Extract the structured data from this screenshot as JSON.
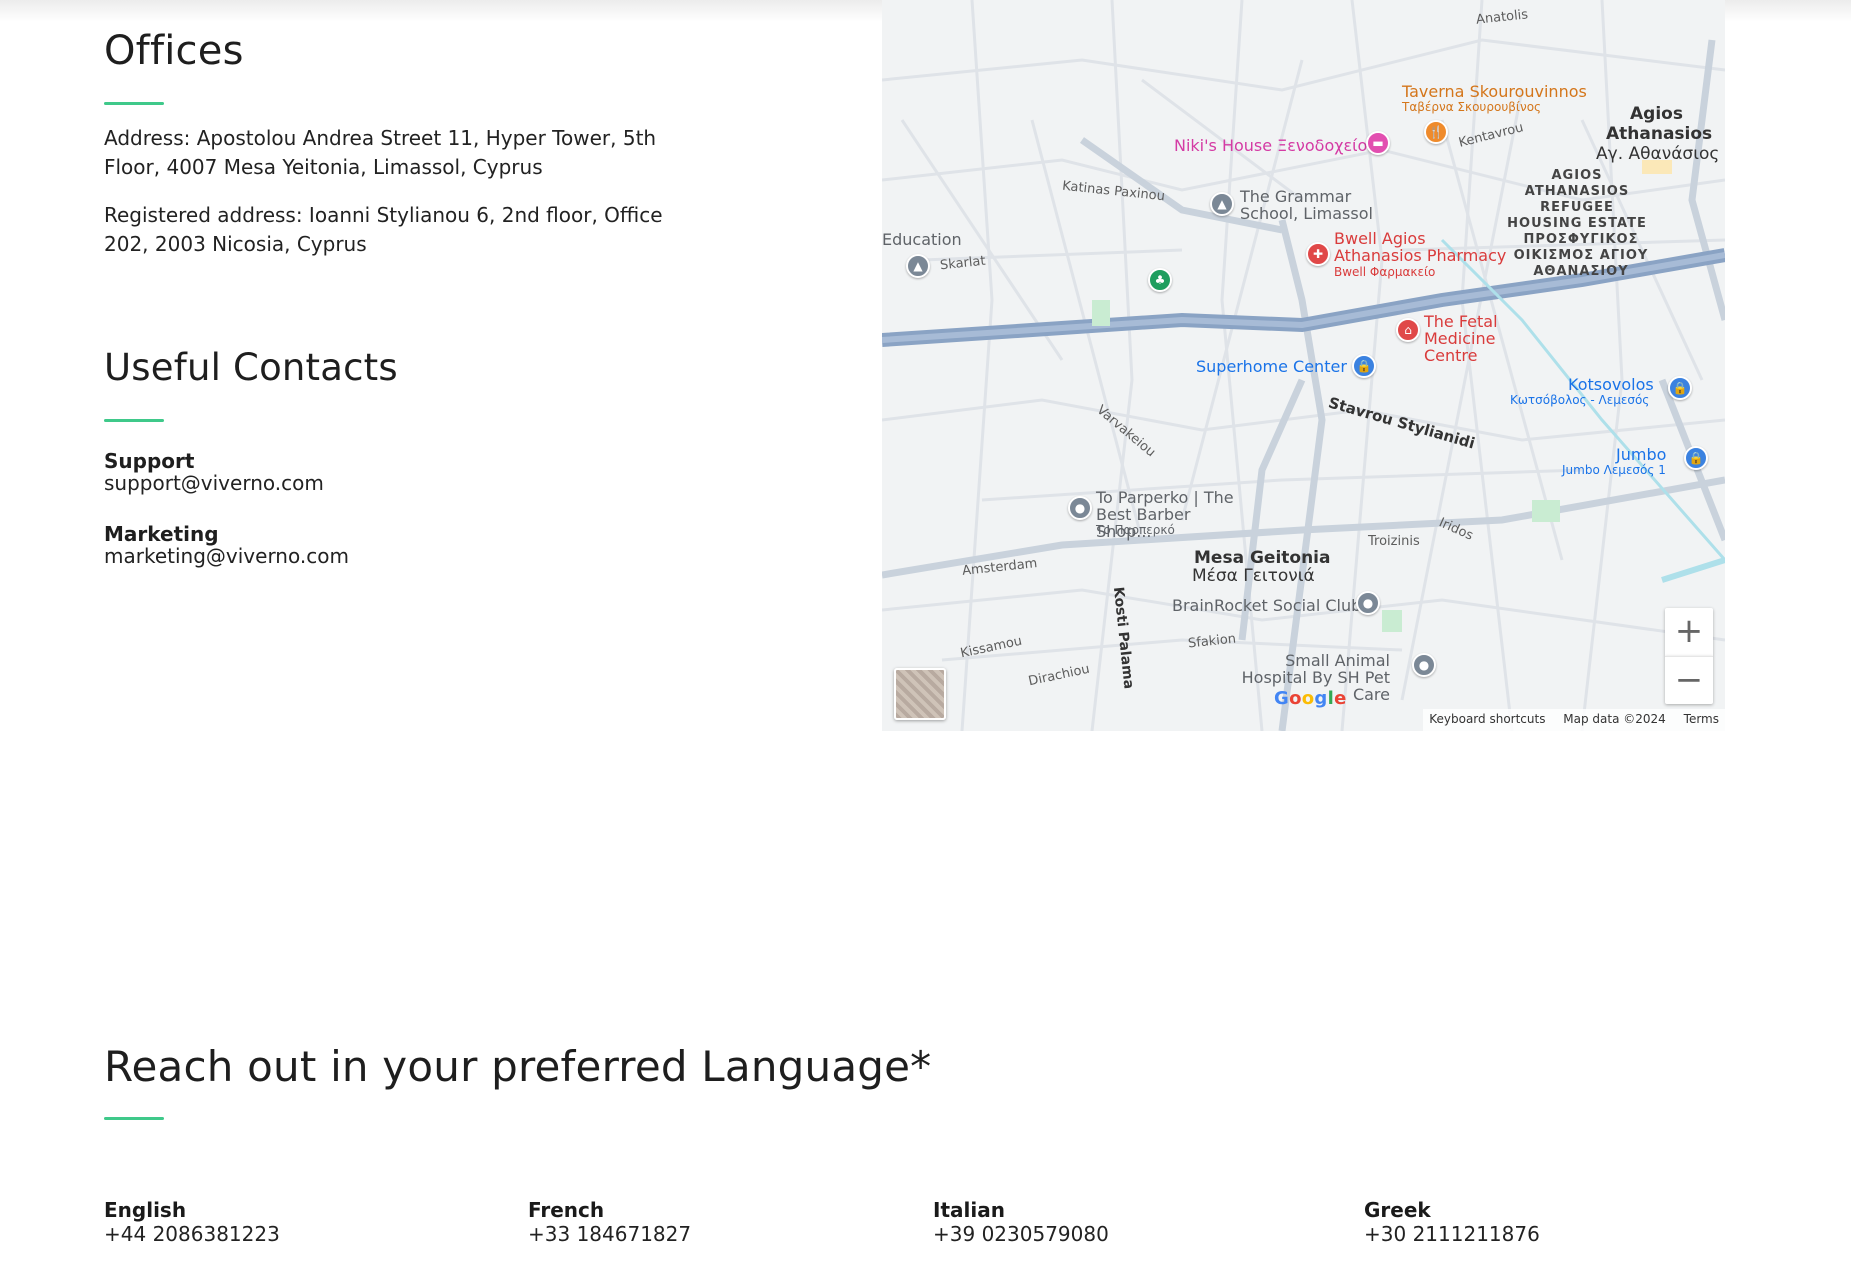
{
  "offices": {
    "title": "Offices",
    "address": "Address: Apostolou Andrea Street 11, Hyper Tower, 5th Floor, 4007 Mesa Yeitonia, Limassol, Cyprus",
    "registered": "Registered address: Ioanni Stylianou 6, 2nd floor, Office 202, 2003 Nicosia, Cyprus"
  },
  "contacts": {
    "title": "Useful Contacts",
    "items": [
      {
        "label": "Support",
        "value": "support@viverno.com"
      },
      {
        "label": "Marketing",
        "value": "marketing@viverno.com"
      }
    ]
  },
  "languages": {
    "title": "Reach out in your preferred Language*",
    "items": [
      {
        "name": "English",
        "phone": "+44 2086381223"
      },
      {
        "name": "French",
        "phone": "+33 184671827"
      },
      {
        "name": "Italian",
        "phone": "+39 0230579080"
      },
      {
        "name": "Greek",
        "phone": "+30 2111211876"
      }
    ]
  },
  "map": {
    "labels": {
      "agios": "Agios",
      "athanasios": "Athanasios",
      "ag_gr": "Αγ. Αθανάσιος",
      "refugee": "AGIOS ATHANASIOS REFUGEE HOUSING ESTATE",
      "refugee_gr": "ΠΡΟΣΦΥΓΙΚΟΣ ΟΙΚΙΣΜΟΣ ΑΓΙΟΥ ΑΘΑΝΑΣΙΟΥ",
      "mesa": "Mesa Geitonia",
      "mesa_gr": "Μέσα Γειτονιά",
      "taverna": "Taverna Skourouvinnos",
      "taverna_gr": "Ταβέρνα Σκουρουβίνος",
      "nikis": "Niki's House Ξενοδοχείο",
      "grammar": "The Grammar School, Limassol",
      "bwell": "Bwell Agios Athanasios Pharmacy",
      "bwell_gr": "Bwell Φαρμακείο",
      "fetal": "The Fetal Medicine Centre",
      "superhome": "Superhome Center",
      "kotsovolos": "Kotsovolos",
      "kotsovolos_gr": "Κωτσόβολος - Λεμεσός",
      "jumbo": "Jumbo",
      "jumbo_gr": "Jumbo Λεμεσός 1",
      "parperko": "To Parperko | The Best Barber Shop...",
      "parperko_gr": "Το Παρπερκό",
      "brainrocket": "BrainRocket Social Club",
      "smallanimal": "Small Animal Hospital By SH Pet Care",
      "education": "Education",
      "stavrou": "Stavrou Stylianidi",
      "kosti": "Kosti Palama",
      "katinas": "Katinas Paxinou",
      "troizinis": "Troizinis",
      "amsterdam": "Amsterdam",
      "kissamou": "Kissamou",
      "dirachiou": "Dirachiou",
      "iridos": "Iridos",
      "sfakion": "Sfakion",
      "skarlat": "Skarlat",
      "kentavrou": "Kentavrou",
      "varvakeiou": "Varvakeiou",
      "anatolis": "Anatolis"
    },
    "zoom_in": "+",
    "zoom_out": "−",
    "google": "Google",
    "attribution": {
      "shortcuts": "Keyboard shortcuts",
      "data": "Map data ©2024",
      "terms": "Terms"
    }
  }
}
